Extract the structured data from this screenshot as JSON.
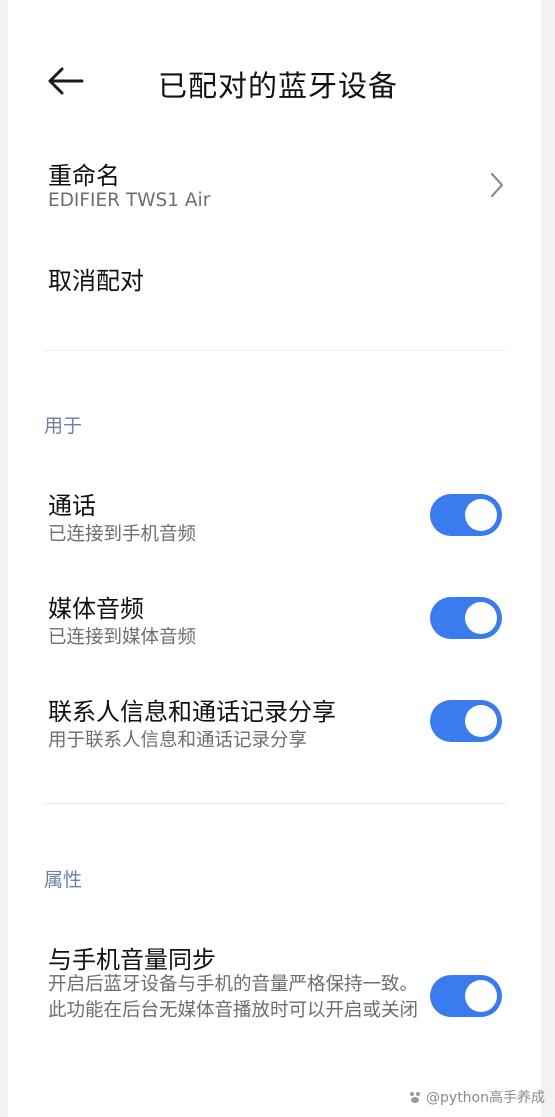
{
  "header": {
    "title": "已配对的蓝牙设备"
  },
  "rename": {
    "title": "重命名",
    "value": "EDIFIER TWS1 Air"
  },
  "unpair": {
    "title": "取消配对"
  },
  "sections": {
    "usage": {
      "label": "用于",
      "items": [
        {
          "title": "通话",
          "subtitle": "已连接到手机音频",
          "enabled": true
        },
        {
          "title": "媒体音频",
          "subtitle": "已连接到媒体音频",
          "enabled": true
        },
        {
          "title": "联系人信息和通话记录分享",
          "subtitle": "用于联系人信息和通话记录分享",
          "enabled": true
        }
      ]
    },
    "properties": {
      "label": "属性",
      "items": [
        {
          "title": "与手机音量同步",
          "subtitle": "开启后蓝牙设备与手机的音量严格保持一致。此功能在后台无媒体音播放时可以开启或关闭",
          "enabled": true
        }
      ]
    }
  },
  "colors": {
    "accent": "#3a7bf0",
    "section_label": "#6f7fa8"
  },
  "icons": {
    "back": "arrow-left-icon",
    "chevron": "chevron-right-icon"
  },
  "watermark": {
    "text": "@python高手养成"
  }
}
